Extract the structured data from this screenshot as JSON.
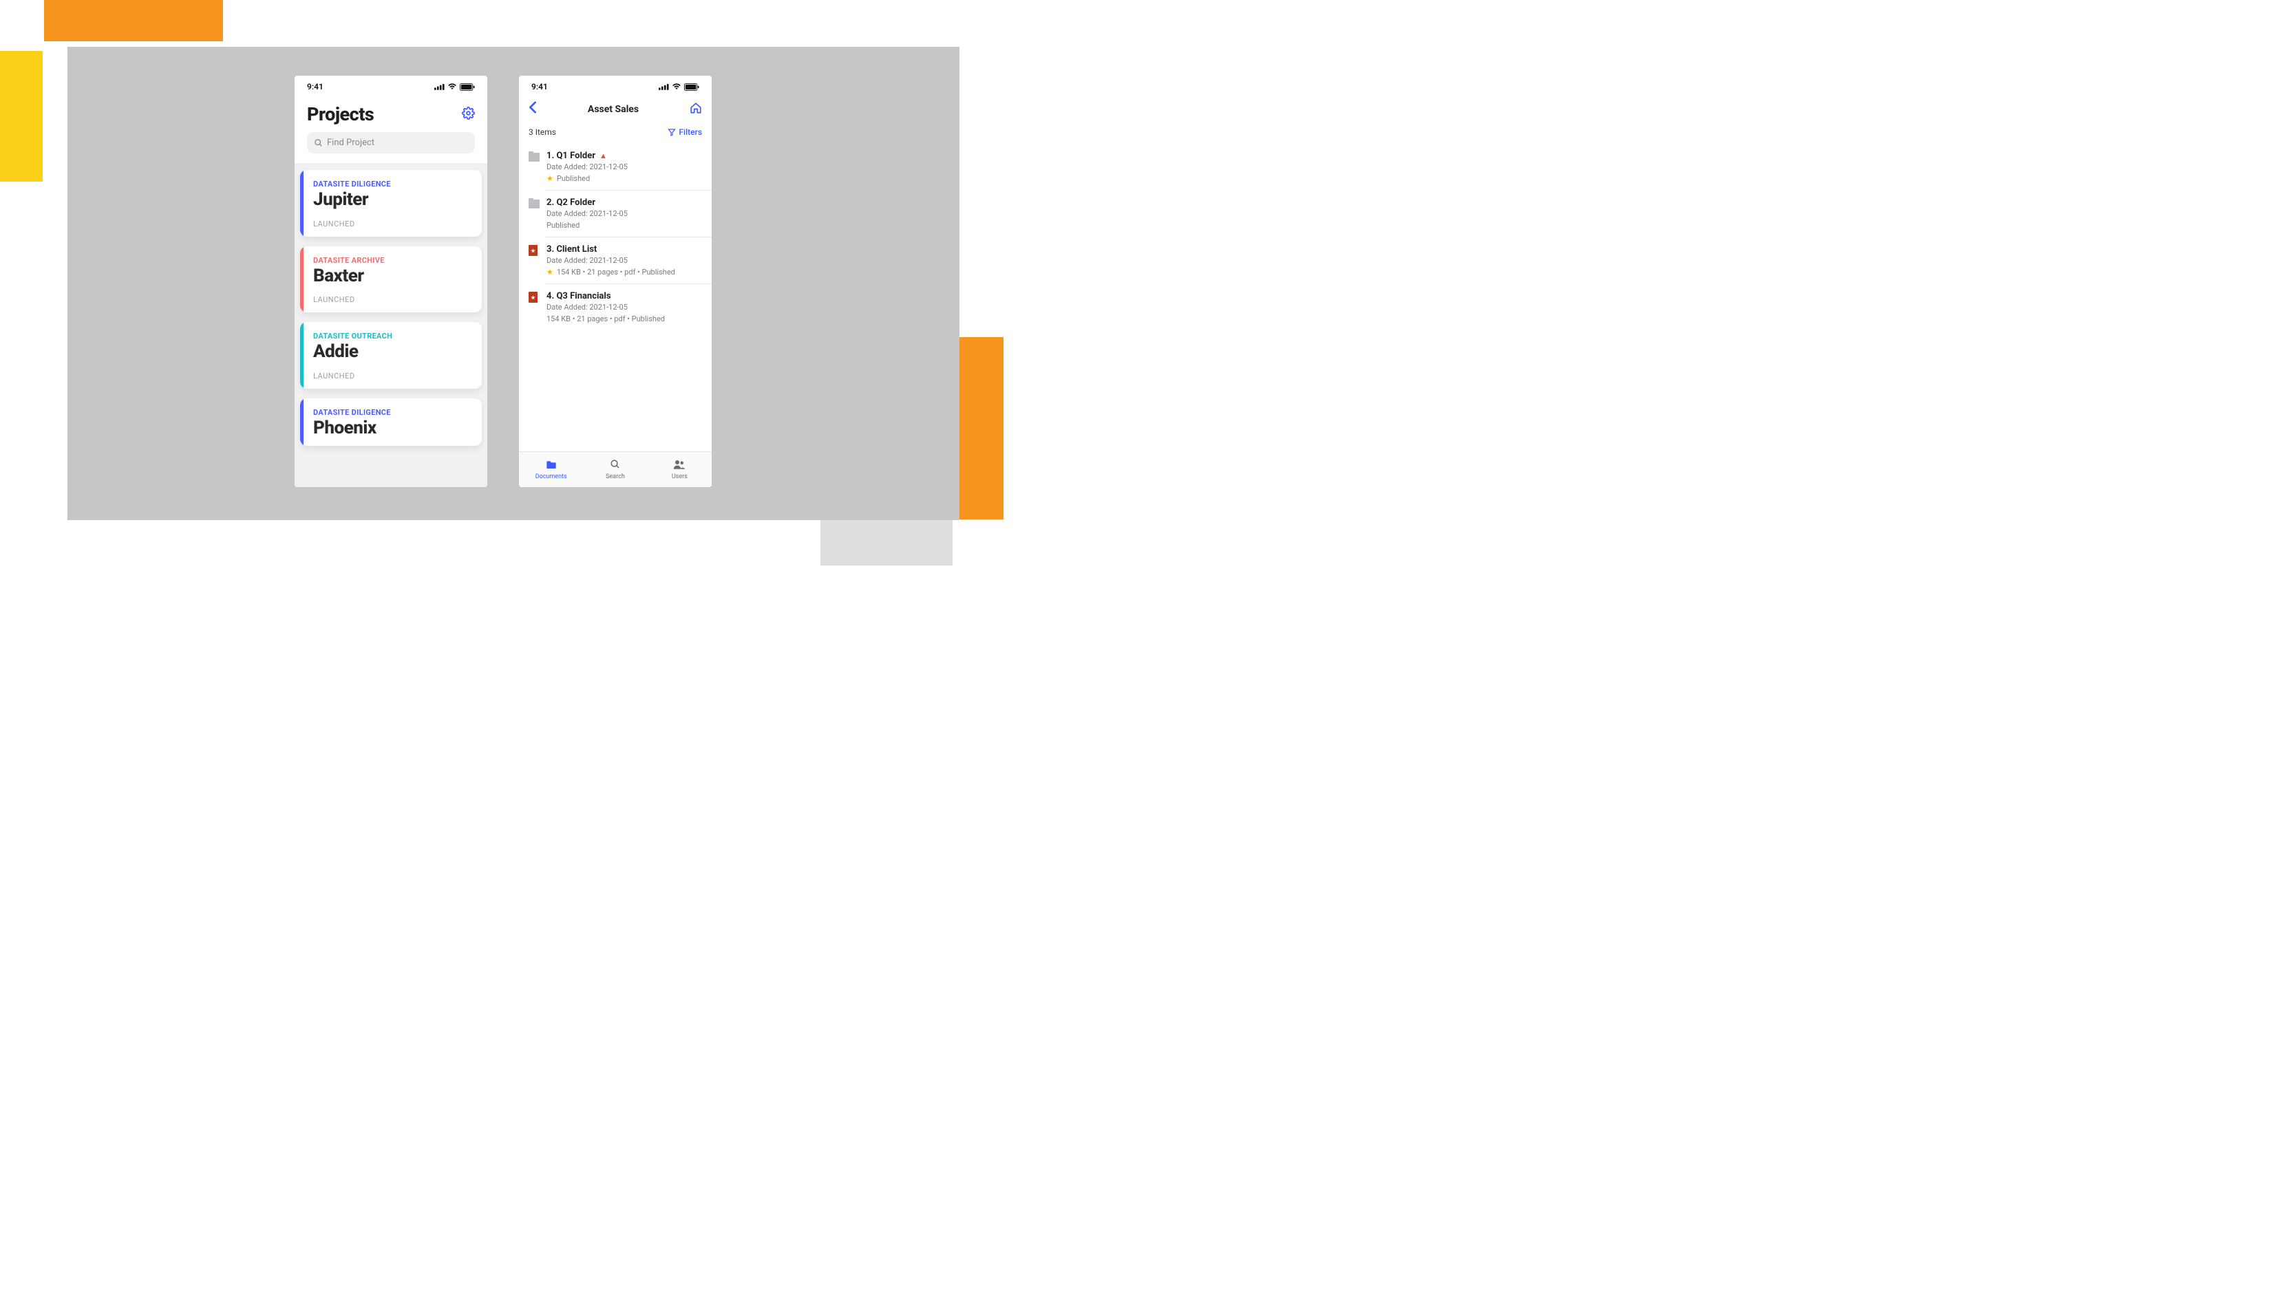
{
  "status_bar": {
    "time": "9:41"
  },
  "screen1": {
    "title": "Projects",
    "search_placeholder": "Find Project",
    "projects": [
      {
        "category": "DATASITE DILIGENCE",
        "name": "Jupiter",
        "status": "LAUNCHED",
        "accent": "#4F5BFF",
        "cat_color": "#4F5BFF"
      },
      {
        "category": "DATASITE ARCHIVE",
        "name": "Baxter",
        "status": "LAUNCHED",
        "accent": "#F66B6B",
        "cat_color": "#F66B6B"
      },
      {
        "category": "DATASITE OUTREACH",
        "name": "Addie",
        "status": "LAUNCHED",
        "accent": "#1BBDC9",
        "cat_color": "#1BBDC9"
      },
      {
        "category": "DATASITE DILIGENCE",
        "name": "Phoenix",
        "status": "",
        "accent": "#4F5BFF",
        "cat_color": "#4F5BFF"
      }
    ]
  },
  "screen2": {
    "nav_title": "Asset Sales",
    "item_count": "3 Items",
    "filters_label": "Filters",
    "files": [
      {
        "type": "folder",
        "name": "1.  Q1 Folder",
        "warn": true,
        "date": "Date Added: 2021-12-05",
        "star": true,
        "meta": "Published"
      },
      {
        "type": "folder",
        "name": "2.  Q2 Folder",
        "warn": false,
        "date": "Date Added: 2021-12-05",
        "star": false,
        "meta": "Published"
      },
      {
        "type": "pdf",
        "name": "3.  Client List",
        "warn": false,
        "date": "Date Added: 2021-12-05",
        "star": true,
        "meta": "154 KB  •  21 pages  •  pdf  •  Published"
      },
      {
        "type": "pdf",
        "name": "4.  Q3 Financials",
        "warn": false,
        "date": "Date Added: 2021-12-05",
        "star": false,
        "meta": "154 KB  •  21 pages  •  pdf  •  Published"
      }
    ],
    "tabs": [
      {
        "label": "Documents",
        "active": true
      },
      {
        "label": "Search",
        "active": false
      },
      {
        "label": "Users",
        "active": false
      }
    ]
  }
}
